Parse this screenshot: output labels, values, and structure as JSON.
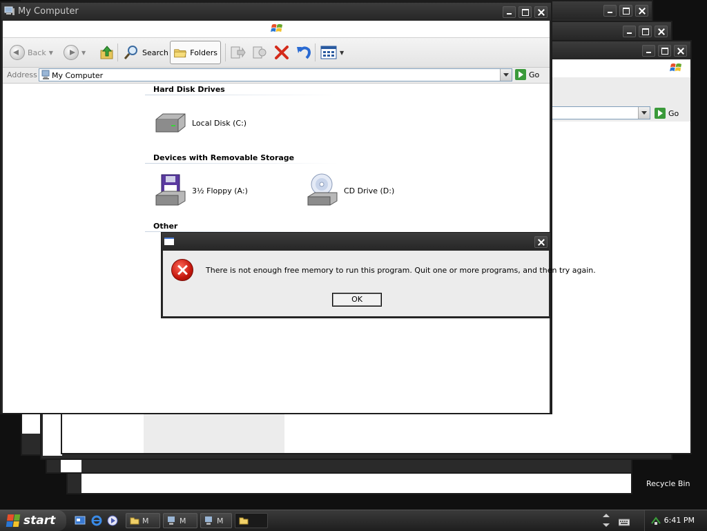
{
  "window": {
    "title": "My Computer"
  },
  "toolbar": {
    "back_label": "Back",
    "search_label": "Search",
    "folders_label": "Folders"
  },
  "address": {
    "label": "Address",
    "value": "My Computer",
    "go_label": "Go"
  },
  "groups": {
    "hard_disks": {
      "title": "Hard Disk Drives",
      "items": [
        {
          "label": "Local Disk (C:)",
          "icon": "hard-disk-icon"
        }
      ]
    },
    "removable": {
      "title": "Devices with Removable Storage",
      "items": [
        {
          "label": "3½ Floppy (A:)",
          "icon": "floppy-drive-icon"
        },
        {
          "label": "CD Drive (D:)",
          "icon": "cd-drive-icon"
        }
      ]
    },
    "other": {
      "title": "Other"
    }
  },
  "dialog": {
    "message": "There is not enough free memory to run this program. Quit one or more programs, and then try again.",
    "ok_label": "OK",
    "icon": "error-icon"
  },
  "desktop": {
    "recycle_bin_label": "Recycle Bin"
  },
  "taskbar": {
    "start_label": "start",
    "tasks": [
      "M",
      "M",
      "M"
    ],
    "clock": "6:41 PM"
  },
  "colors": {
    "error_red": "#c4160c",
    "go_green": "#3a9a3a",
    "dark_chrome": "#2a2a2a"
  }
}
